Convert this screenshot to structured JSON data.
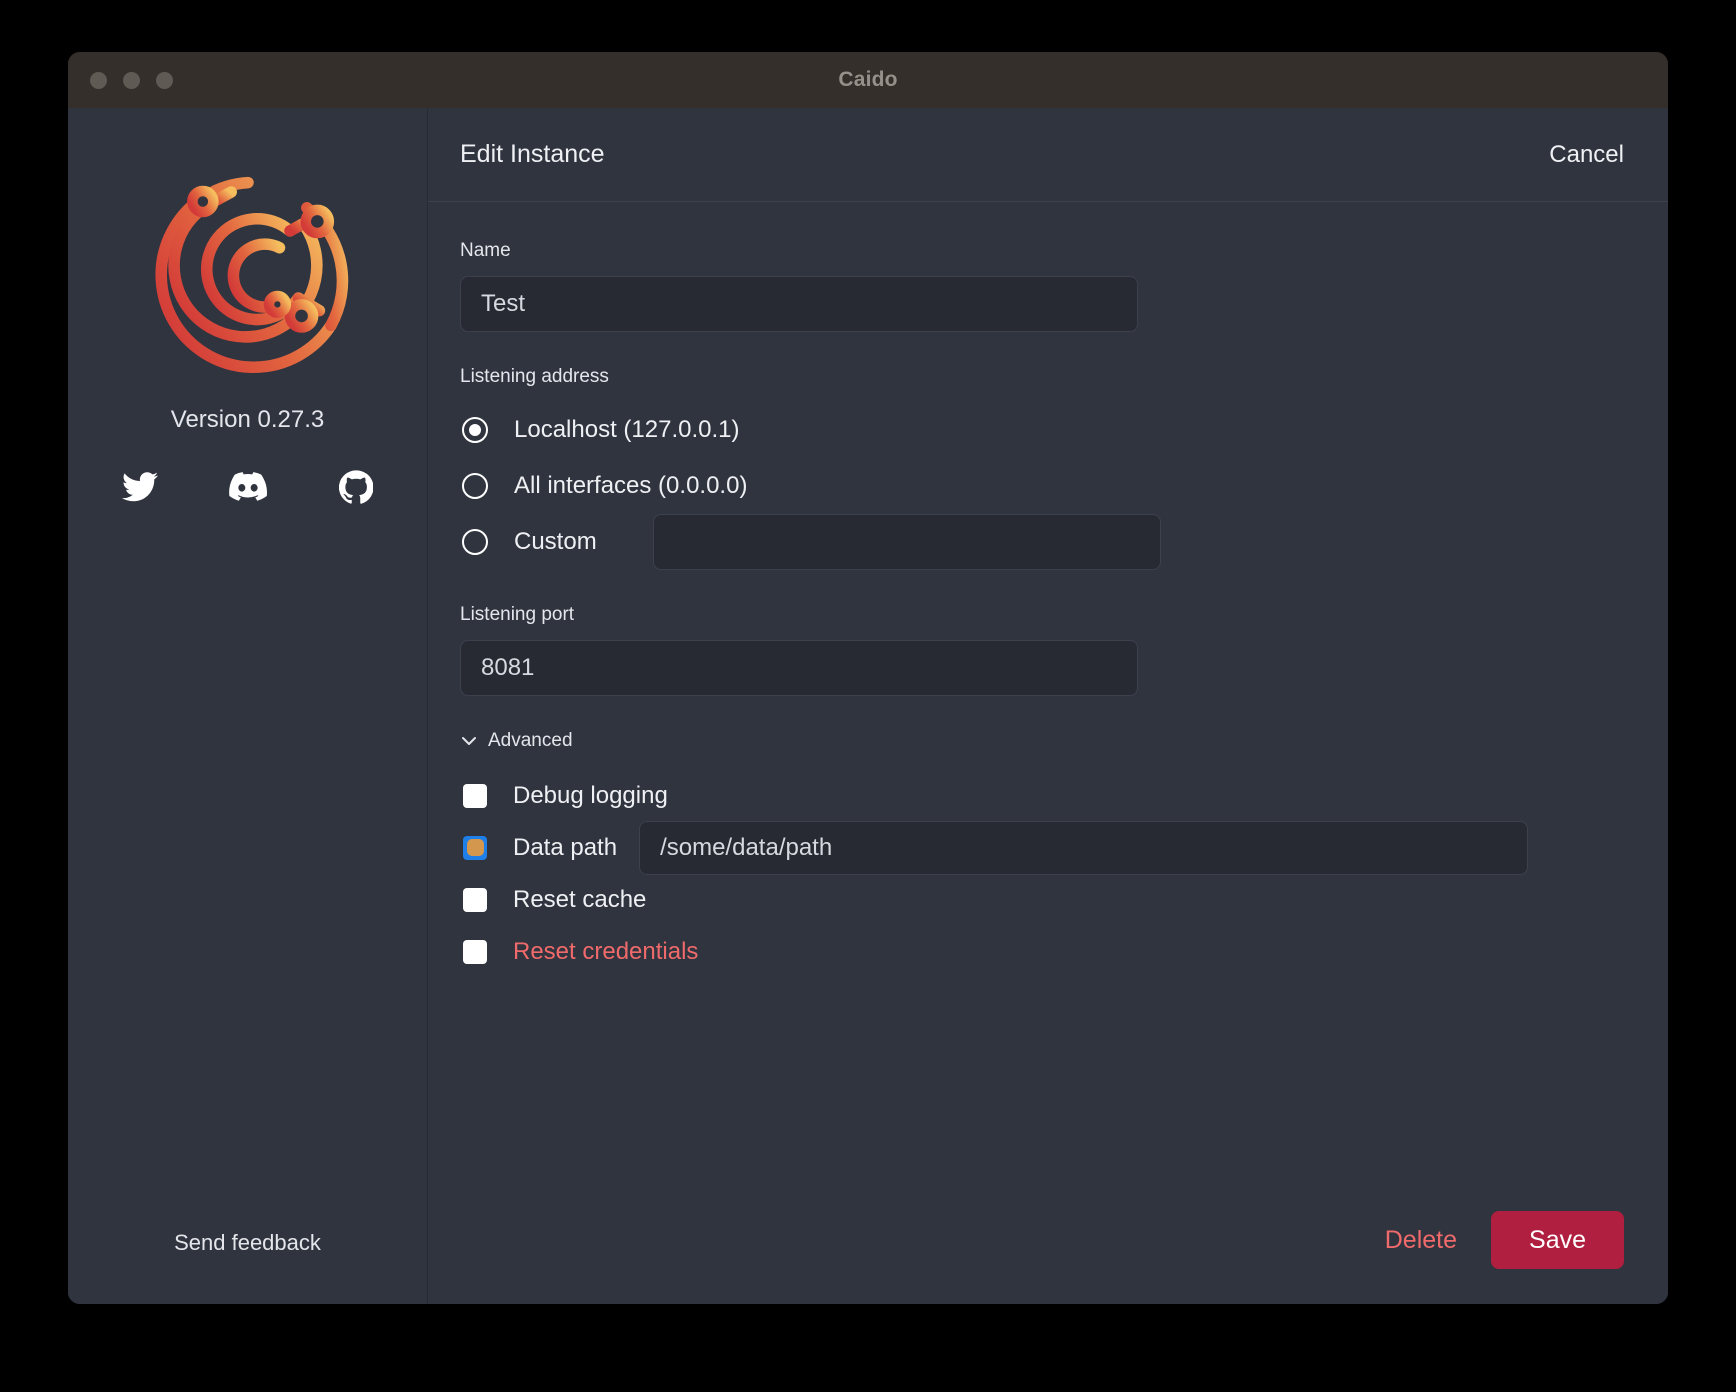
{
  "window": {
    "title": "Caido",
    "traffic_lights": [
      "close",
      "minimize",
      "maximize"
    ]
  },
  "sidebar": {
    "logo_alt": "caido-logo",
    "version": "Version 0.27.3",
    "social": [
      {
        "name": "twitter-icon",
        "label": "Twitter"
      },
      {
        "name": "discord-icon",
        "label": "Discord"
      },
      {
        "name": "github-icon",
        "label": "GitHub"
      }
    ],
    "send_feedback": "Send feedback"
  },
  "header": {
    "title": "Edit Instance",
    "cancel_label": "Cancel"
  },
  "form": {
    "name": {
      "label": "Name",
      "value": "Test",
      "placeholder": ""
    },
    "listening_address": {
      "label": "Listening address",
      "options": [
        {
          "label": "Localhost (127.0.0.1)",
          "selected": true
        },
        {
          "label": "All interfaces (0.0.0.0)",
          "selected": false
        },
        {
          "label": "Custom",
          "selected": false
        }
      ],
      "custom_value": "",
      "custom_placeholder": ""
    },
    "listening_port": {
      "label": "Listening port",
      "value": "8081",
      "placeholder": ""
    },
    "advanced": {
      "label": "Advanced",
      "expanded": true,
      "chevron": "chevron-down-icon",
      "items": [
        {
          "label": "Debug logging",
          "checked": false,
          "danger": false
        },
        {
          "label": "Data path",
          "checked": true,
          "danger": false
        },
        {
          "label": "Reset cache",
          "checked": false,
          "danger": false
        },
        {
          "label": "Reset credentials",
          "checked": false,
          "danger": true
        }
      ],
      "data_path": {
        "value": "/some/data/path",
        "placeholder": ""
      }
    }
  },
  "footer": {
    "delete_label": "Delete",
    "save_label": "Save"
  },
  "colors": {
    "window_bg": "#30343f",
    "titlebar_bg": "#342f2a",
    "input_bg": "#272a33",
    "accent_save": "#b01f40",
    "danger_text": "#ef6a6a",
    "checkbox_checked": "#1f7fe8",
    "logo_gradient_start": "#d6423c",
    "logo_gradient_end": "#f2b350"
  }
}
